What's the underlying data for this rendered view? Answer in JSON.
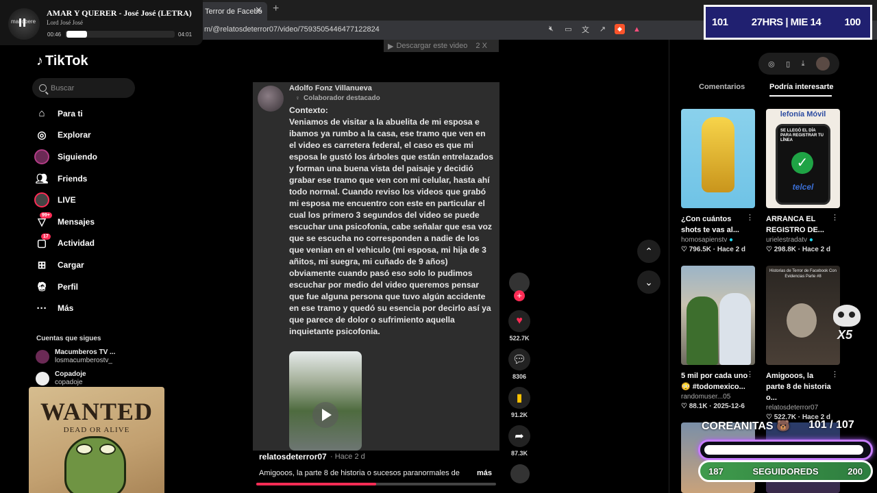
{
  "browser": {
    "tab_title": "Terror de Facebo",
    "url": "m/@relatosdeterror07/video/7593505446477122824"
  },
  "player": {
    "song": "AMAR Y QUERER - José José (LETRA)",
    "artist": "Lord José José",
    "art_label": "mariobere",
    "current": "00:46",
    "total": "04:01",
    "progress": 0.19
  },
  "stats_overlay": {
    "left": "101",
    "center": "27HRS | MIE 14",
    "right": "100"
  },
  "sidebar": {
    "logo": "TikTok",
    "search_placeholder": "Buscar",
    "nav": [
      {
        "label": "Para ti",
        "icon": "home-icon"
      },
      {
        "label": "Explorar",
        "icon": "compass-icon"
      },
      {
        "label": "Siguiendo",
        "icon": "avatar-icon"
      },
      {
        "label": "Friends",
        "icon": "friends-icon"
      },
      {
        "label": "LIVE",
        "icon": "live-avatar-icon"
      },
      {
        "label": "Mensajes",
        "icon": "message-icon",
        "badge": "99+"
      },
      {
        "label": "Actividad",
        "icon": "inbox-icon",
        "badge": "17"
      },
      {
        "label": "Cargar",
        "icon": "upload-icon"
      },
      {
        "label": "Perfil",
        "icon": "profile-avatar-icon"
      },
      {
        "label": "Más",
        "icon": "more-icon"
      }
    ],
    "following_title": "Cuentas que sigues",
    "accounts": [
      {
        "name": "Macumberos TV ...",
        "user": "losmacumberostv_"
      },
      {
        "name": "Copadoje",
        "user": "copadoje"
      }
    ]
  },
  "wanted": {
    "title": "WANTED",
    "subtitle": "DEAD OR ALIVE"
  },
  "download_bar": {
    "label": "Descargar este video",
    "extra": "2 X"
  },
  "comment": {
    "author": "Adolfo Fonz Villanueva",
    "role": "Colaborador destacado",
    "text": "Contexto:\nVeniamos de visitar a la abuelita de mi esposa e ibamos ya rumbo a la casa, ese tramo que ven en el video es carretera federal, el caso es que mi esposa le gustó los árboles que están entrelazados y forman una buena vista del paisaje y decidió grabar ese tramo que ven con mi celular, hasta ahí todo normal. Cuando reviso los videos que grabó mi esposa me encuentro con este en particular el cual los primero 3 segundos del video se puede escuchar una psicofonia, cabe señalar que esa voz que se escucha no corresponden a nadie de los que venian en el vehiculo (mi esposa, mi hija de 3 añitos, mi suegra, mi cuñado de 9 años) obviamente cuando pasó eso solo lo pudimos escuchar por medio del video queremos pensar que fue alguna persona que tuvo algún accidente en ese tramo y quedó su esencia por decirlo así ya que parece de dolor o sufrimiento aquella inquietante psicofonia."
  },
  "video": {
    "user": "relatosdeterror07",
    "time": "· Hace 2 d",
    "description": "Amigooos, la parte 8 de historia o sucesos paranormales de",
    "more": "más",
    "progress": 0.5
  },
  "actions": {
    "likes": "522.7K",
    "comments": "8306",
    "saves": "91.2K",
    "shares": "87.3K"
  },
  "right_panel": {
    "tab_comments": "Comentarios",
    "tab_interesting": "Podría interesarte",
    "cards": [
      {
        "title": "¿Con cuántos shots te vas al...",
        "user": "homosapienstv",
        "views": "796.5K",
        "date": "Hace 2 d",
        "img_text": ""
      },
      {
        "title": "ARRANCA EL REGISTRO DE...",
        "user": "urielestradatv",
        "views": "298.8K",
        "date": "Hace 2 d",
        "img_text": "SE LLEGÓ EL DÍA PARA REGISTRAR TU LÍNEA",
        "img_brand": "telcel",
        "img_header": "lefonía Móvil"
      },
      {
        "title": "5 mil por cada uno 😳 #todomexico...",
        "user": "randomuser...05",
        "views": "88.1K",
        "date": "2025-12-6",
        "img_text": ""
      },
      {
        "title": "Amigooos, la parte 8 de historia o...",
        "user": "relatosdeterror07",
        "views": "522.7K",
        "date": "Hace 2 d",
        "img_text": "Historias de Terror de Facebook Con Evidencias Parte #8"
      }
    ]
  },
  "overlays": {
    "skull_multiplier": "X5",
    "coreanitas": "COREANITAS 🐻",
    "coreanitas_count": "101 / 107",
    "followers_label": "SEGUIDOREDS",
    "followers_current": "187",
    "followers_goal": "200"
  },
  "colors": {
    "accent": "#fe2c55",
    "bg": "#000000",
    "statbox": "#202070",
    "glow": "#c77dff",
    "green": "#3f9b4c"
  }
}
